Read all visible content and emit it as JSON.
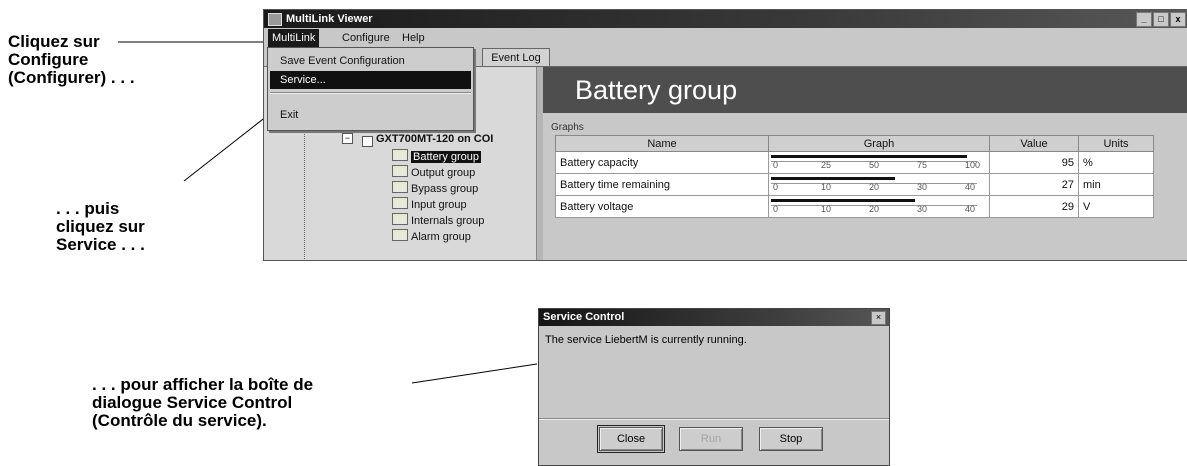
{
  "callouts": {
    "first": "Cliquez sur\nConfigure\n(Configurer) . . .",
    "second": ". . . puis\ncliquez sur\nService . . .",
    "third": ". . . pour afficher la boîte de\ndialogue Service Control\n(Contrôle du service)."
  },
  "window": {
    "title": "MultiLink Viewer",
    "controls": [
      "_",
      "□",
      "x"
    ],
    "menu": [
      "MultiLink",
      "Configure",
      "Help"
    ],
    "dropdown": [
      "Save Event Configuration",
      "Service...",
      "Exit"
    ],
    "tab": "Event Log",
    "tree": {
      "node": "GXT700MT-120 on COI",
      "children": [
        "Battery group",
        "Output group",
        "Bypass group",
        "Input group",
        "Internals group",
        "Alarm group"
      ]
    },
    "panel": {
      "title": "Battery group",
      "section": "Graphs",
      "headers": [
        "Name",
        "Graph",
        "Value",
        "Units"
      ],
      "ticks": [
        "0",
        "25",
        "50",
        "75",
        "100"
      ],
      "rows": [
        {
          "name": "Battery capacity",
          "value": "95",
          "units": "%",
          "level": 0.95,
          "ticks": [
            "0",
            "25",
            "50",
            "75",
            "100"
          ]
        },
        {
          "name": "Battery time remaining",
          "value": "27",
          "units": "min",
          "level": 0.6,
          "ticks": [
            "0",
            "10",
            "20",
            "30",
            "40"
          ]
        },
        {
          "name": "Battery voltage",
          "value": "29",
          "units": "V",
          "level": 0.7,
          "ticks": [
            "0",
            "10",
            "20",
            "30",
            "40"
          ]
        }
      ]
    }
  },
  "dialog": {
    "title": "Service Control",
    "message": "The service LiebertM is currently running.",
    "buttons": [
      "Close",
      "Run",
      "Stop"
    ]
  }
}
